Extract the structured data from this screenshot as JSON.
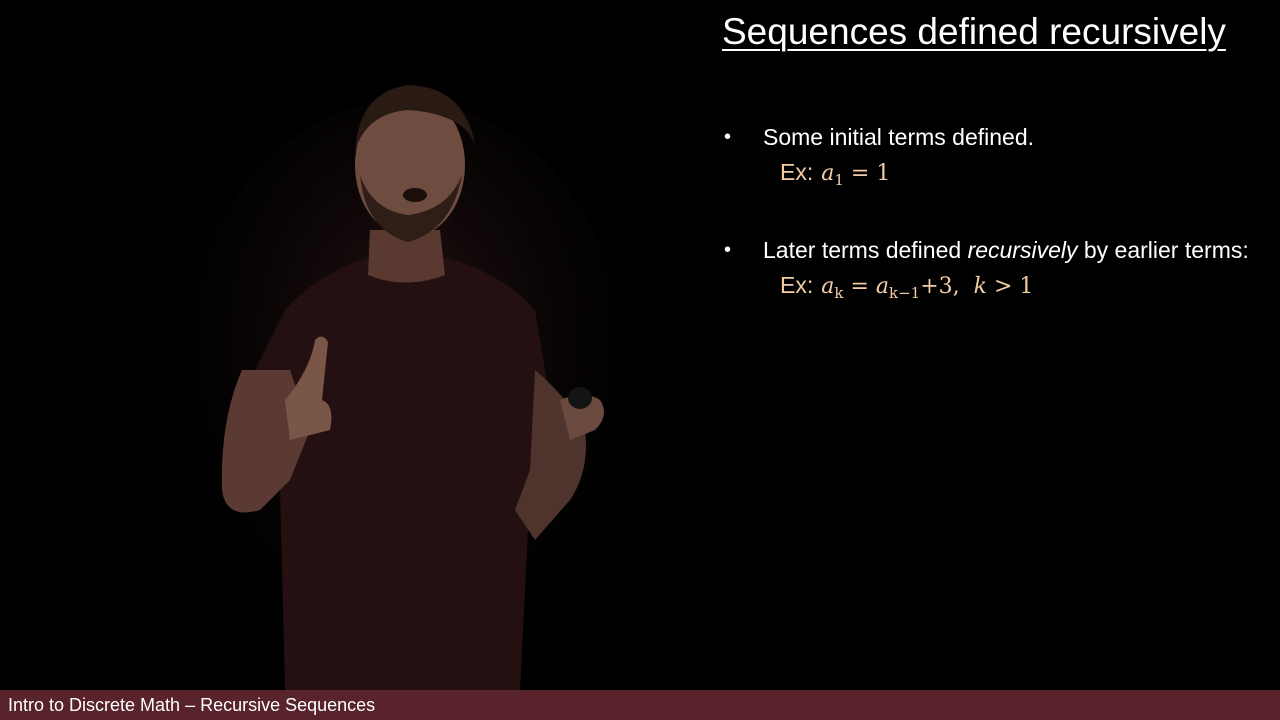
{
  "slide": {
    "title": "Sequences defined recursively",
    "bullet_char": "•",
    "bullets": [
      {
        "text": "Some initial terms defined.",
        "example": {
          "label": "Ex:",
          "base": "a",
          "sub": "1",
          "rest": " = 1"
        }
      },
      {
        "text_before": "Later terms defined ",
        "text_emph": "recursively",
        "text_after": " by earlier terms:",
        "example": {
          "label": "Ex:",
          "lhs_base": "a",
          "lhs_sub": "k",
          "eq": " = ",
          "rhs_base": "a",
          "rhs_sub": "k−1",
          "plus": "+3,",
          "cond_var": "k",
          "cond_rest": " > 1"
        }
      }
    ]
  },
  "footer": {
    "text": "Intro to Discrete Math – Recursive Sequences",
    "bg_color": "#58232b"
  },
  "colors": {
    "example_text": "#f3cca5",
    "text": "#ffffff"
  }
}
